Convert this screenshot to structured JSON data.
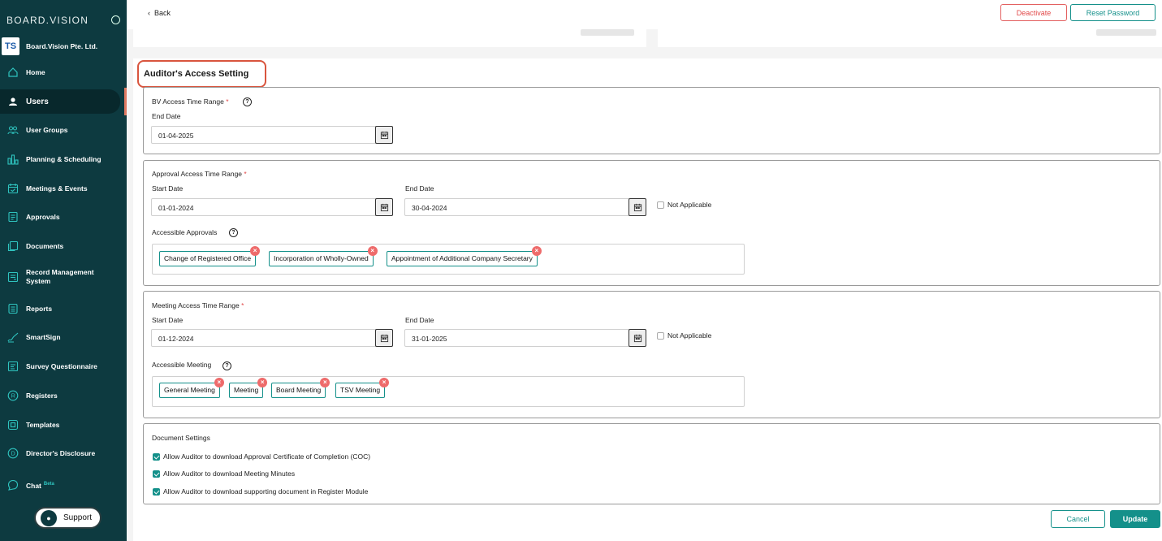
{
  "sidebar": {
    "brand": "BOARD.VISION",
    "company": "Board.Vision Pte. Ltd.",
    "company_logo": "TS",
    "items": [
      {
        "label": "Home",
        "icon": "home-icon"
      },
      {
        "label": "Users",
        "icon": "user-icon"
      },
      {
        "label": "User Groups",
        "icon": "user-groups-icon"
      },
      {
        "label": "Planning & Scheduling",
        "icon": "bar-chart-icon"
      },
      {
        "label": "Meetings & Events",
        "icon": "calendar-icon"
      },
      {
        "label": "Approvals",
        "icon": "approval-icon"
      },
      {
        "label": "Documents",
        "icon": "documents-icon"
      },
      {
        "label": "Record Management System",
        "icon": "record-icon"
      },
      {
        "label": "Reports",
        "icon": "reports-icon"
      },
      {
        "label": "SmartSign",
        "icon": "signature-icon"
      },
      {
        "label": "Survey Questionnaire",
        "icon": "survey-icon"
      },
      {
        "label": "Registers",
        "icon": "registers-icon"
      },
      {
        "label": "Templates",
        "icon": "templates-icon"
      },
      {
        "label": "Director's Disclosure",
        "icon": "disclosure-icon"
      },
      {
        "label": "Chat",
        "icon": "chat-icon",
        "badge": "Beta"
      }
    ],
    "support": "Support"
  },
  "topbar": {
    "back": "Back",
    "deactivate": "Deactivate",
    "reset_password": "Reset Password"
  },
  "section_title": "Auditor's Access Setting",
  "bv_access": {
    "title": "BV Access Time Range",
    "end_label": "End Date",
    "end_value": "01-04-2025"
  },
  "approval_access": {
    "title": "Approval Access Time Range",
    "start_label": "Start Date",
    "start_value": "01-01-2024",
    "end_label": "End Date",
    "end_value": "30-04-2024",
    "not_applicable": "Not Applicable",
    "accessible_label": "Accessible Approvals",
    "tags": [
      "Change of Registered Office",
      "Incorporation of Wholly-Owned",
      "Appointment of Additional Company Secretary"
    ]
  },
  "meeting_access": {
    "title": "Meeting Access Time Range",
    "start_label": "Start Date",
    "start_value": "01-12-2024",
    "end_label": "End Date",
    "end_value": "31-01-2025",
    "not_applicable": "Not Applicable",
    "accessible_label": "Accessible Meeting",
    "tags": [
      "General Meeting",
      "Meeting",
      "Board Meeting",
      "TSV Meeting"
    ]
  },
  "document_settings": {
    "title": "Document Settings",
    "options": [
      "Allow Auditor to download Approval Certificate of Completion (COC)",
      "Allow Auditor to download Meeting Minutes",
      "Allow Auditor to download supporting document in Register Module"
    ]
  },
  "footer": {
    "cancel": "Cancel",
    "update": "Update"
  },
  "colors": {
    "sidebar": "#0d3a40",
    "accent": "#14908a",
    "danger": "#e14848",
    "highlight": "#d9553e"
  }
}
